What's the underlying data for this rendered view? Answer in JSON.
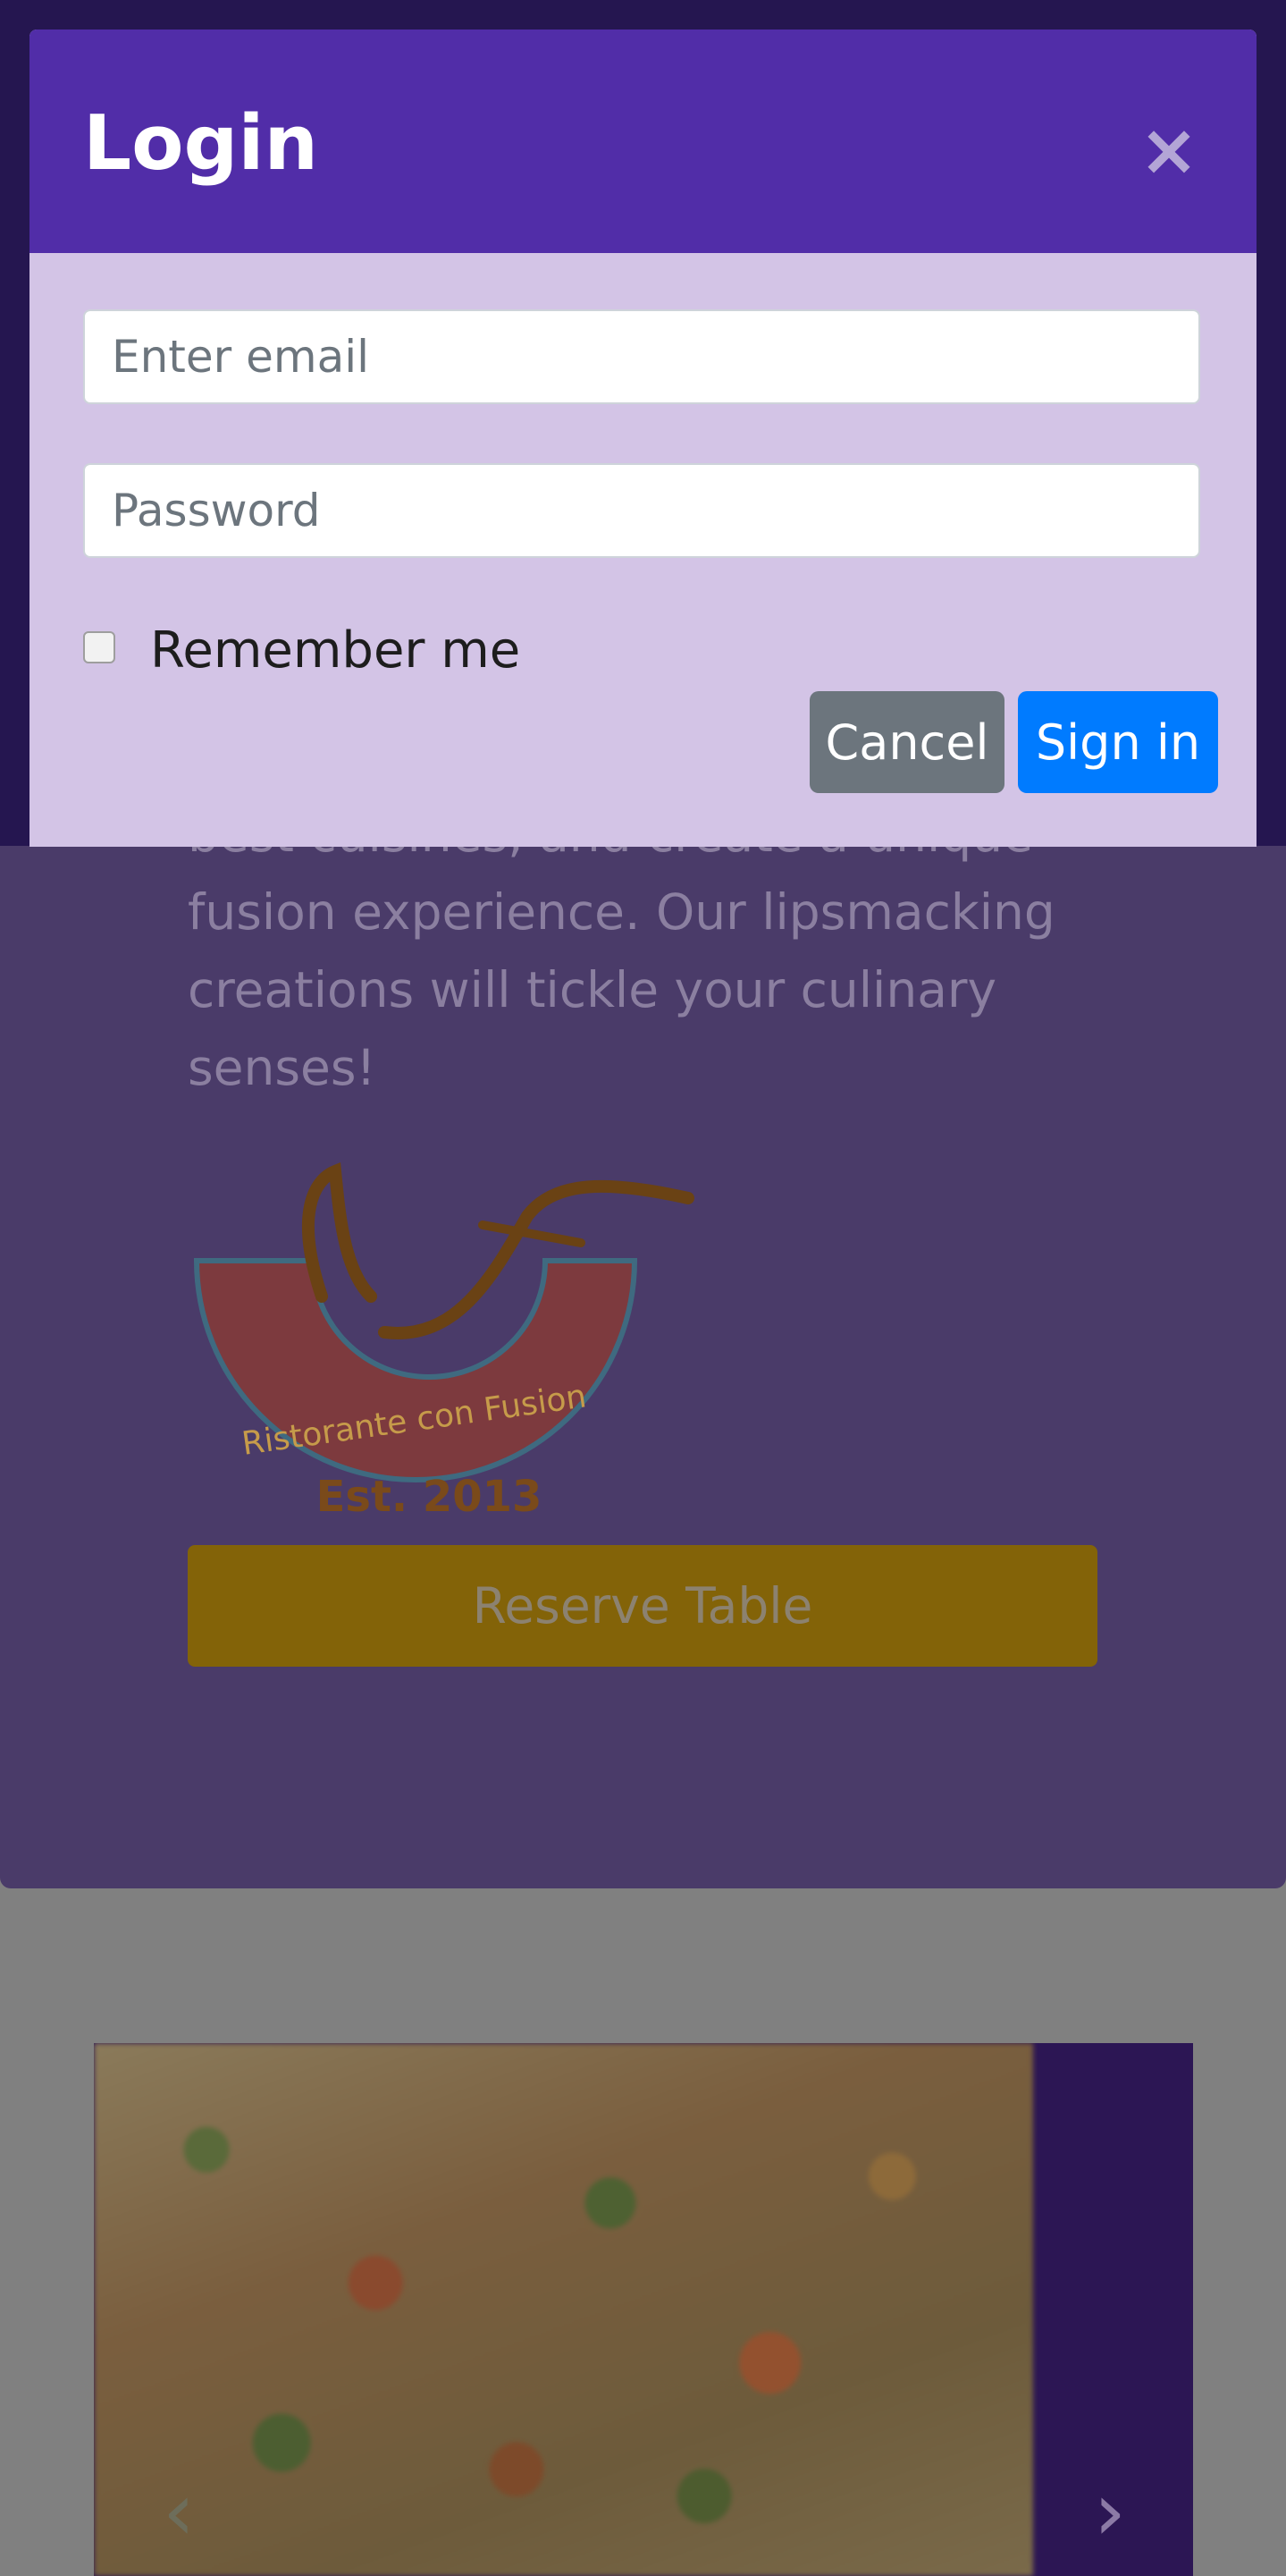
{
  "modal": {
    "title": "Login",
    "close_label": "×",
    "email_placeholder": "Enter email",
    "password_placeholder": "Password",
    "remember_label": "Remember me",
    "cancel_label": "Cancel",
    "signin_label": "Sign in"
  },
  "jumbotron": {
    "text_lines": [
      "best cuisines, and create a unique",
      "fusion experience. Our lipsmacking",
      "creations will tickle your culinary",
      "senses!"
    ],
    "logo_text": "Ristorante con Fusion",
    "logo_est": "Est. 2013",
    "reserve_label": "Reserve Table"
  },
  "carousel": {
    "prev_icon": "chevron-left-icon",
    "next_icon": "chevron-right-icon",
    "prev_glyph": "‹",
    "next_glyph": "›"
  },
  "colors": {
    "header": "#512da8",
    "modal_body": "#d3c4e6",
    "cancel": "#6c757d",
    "signin": "#007bff",
    "reserve": "#ffc107"
  }
}
